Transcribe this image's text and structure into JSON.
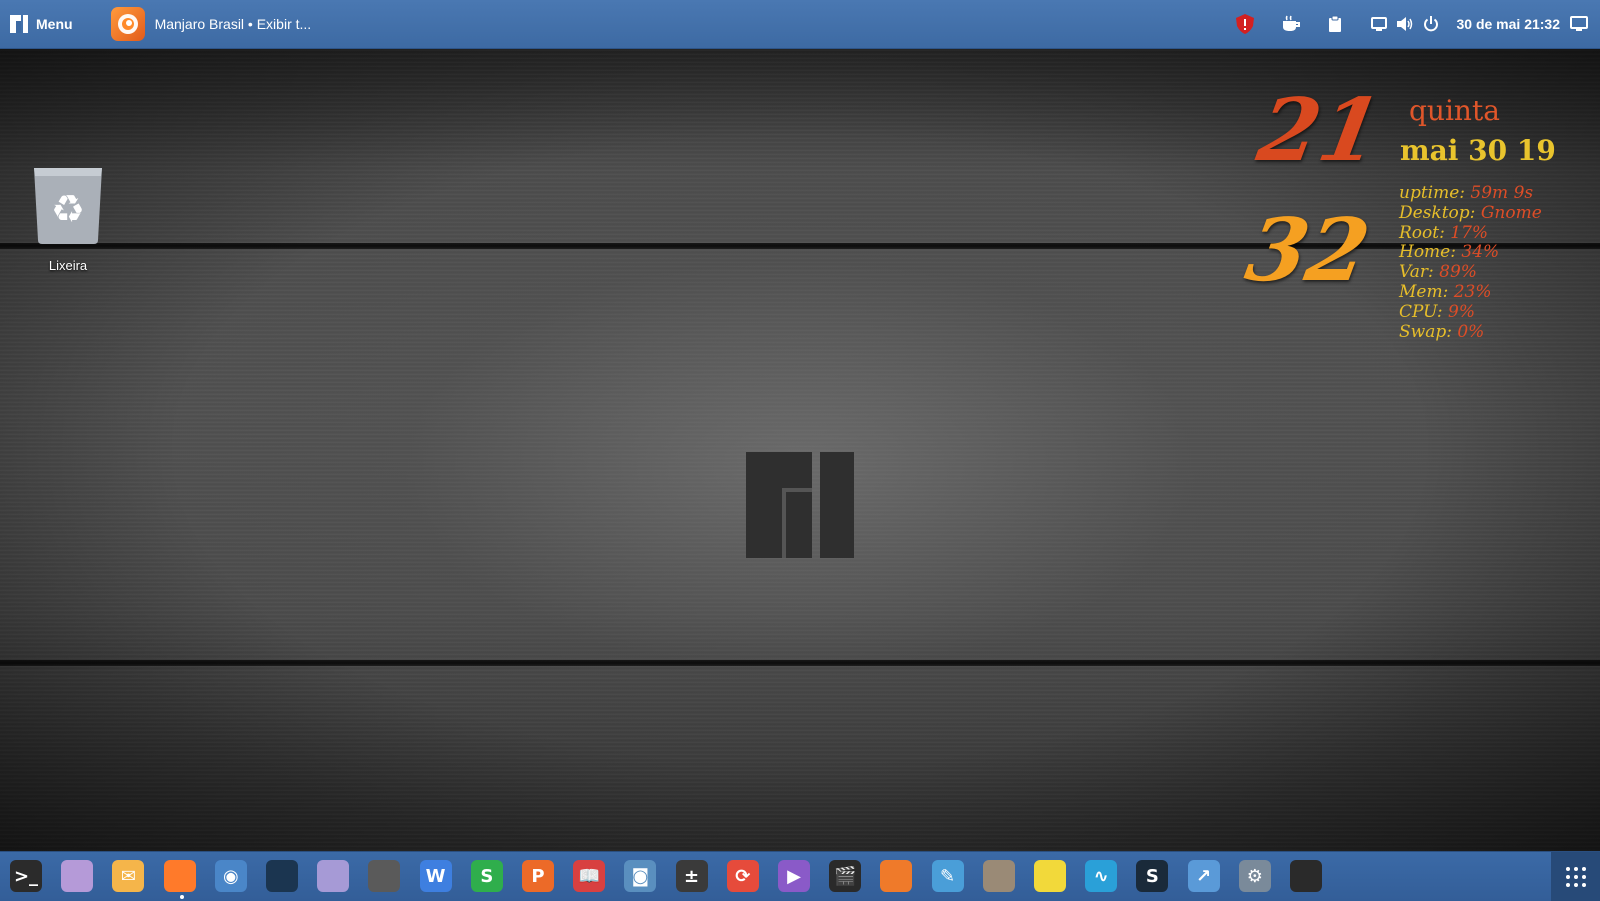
{
  "top_bar": {
    "menu_label": "Menu",
    "active_window_title": "Manjaro Brasil • Exibir t...",
    "tray_icons": [
      "shield-alert-icon",
      "coffee-icon",
      "clipboard-icon",
      "screen-icon",
      "volume-icon",
      "power-icon"
    ],
    "clock": "30 de mai  21:32",
    "show_desktop_icon": "show-desktop-icon"
  },
  "desktop": {
    "trash_label": "Lixeira"
  },
  "conky": {
    "hour": "21",
    "minute": "32",
    "weekday": "quinta",
    "date": "mai 30 19",
    "stats": [
      {
        "key": "uptime:",
        "value": "59m 9s"
      },
      {
        "key": "Desktop:",
        "value": " Gnome"
      },
      {
        "key": "Root:",
        "value": "17%"
      },
      {
        "key": "Home:",
        "value": "34%"
      },
      {
        "key": "Var:",
        "value": "89%"
      },
      {
        "key": "Mem:",
        "value": "23%"
      },
      {
        "key": "CPU:",
        "value": "9%"
      },
      {
        "key": "Swap:",
        "value": "0%"
      }
    ],
    "colors": {
      "hour": "#d9491f",
      "minute": "#f5a021",
      "label": "#e7be2a",
      "value": "#dd4d27"
    }
  },
  "dock": {
    "apps": [
      {
        "name": "terminal-icon",
        "color": "#2b2b2b",
        "glyph": ">_"
      },
      {
        "name": "files-icon",
        "color": "#b59ad8",
        "glyph": ""
      },
      {
        "name": "mail-icon",
        "color": "#f5b54a",
        "glyph": "✉"
      },
      {
        "name": "firefox-icon",
        "color": "#ff7a2a",
        "glyph": ""
      },
      {
        "name": "chrome-icon",
        "color": "#4a86c8",
        "glyph": "◉"
      },
      {
        "name": "steam-icon",
        "color": "#1b3550",
        "glyph": ""
      },
      {
        "name": "text-editor-icon",
        "color": "#a69ad6",
        "glyph": ""
      },
      {
        "name": "document-viewer-icon",
        "color": "#5a5a5a",
        "glyph": ""
      },
      {
        "name": "wps-writer-icon",
        "color": "#3e7fe0",
        "glyph": "W"
      },
      {
        "name": "wps-spreadsheets-icon",
        "color": "#2fae4c",
        "glyph": "S"
      },
      {
        "name": "wps-presentation-icon",
        "color": "#ec6a28",
        "glyph": "P"
      },
      {
        "name": "ebook-reader-icon",
        "color": "#d84040",
        "glyph": "📖"
      },
      {
        "name": "screenshot-icon",
        "color": "#5a8fbf",
        "glyph": "◙"
      },
      {
        "name": "calculator-icon",
        "color": "#3a3a3a",
        "glyph": "±"
      },
      {
        "name": "software-update-icon",
        "color": "#e64b3b",
        "glyph": "⟳"
      },
      {
        "name": "media-player-icon",
        "color": "#8a5ac8",
        "glyph": "▶"
      },
      {
        "name": "video-editor-icon",
        "color": "#2a2a2a",
        "glyph": "🎬"
      },
      {
        "name": "feather-app-icon",
        "color": "#ef7a2a",
        "glyph": ""
      },
      {
        "name": "drawing-app-icon",
        "color": "#4a9ed8",
        "glyph": "✎"
      },
      {
        "name": "gimp-icon",
        "color": "#9a8a76",
        "glyph": ""
      },
      {
        "name": "sticky-notes-icon",
        "color": "#f2d93a",
        "glyph": ""
      },
      {
        "name": "system-monitor-icon",
        "color": "#2aa0d8",
        "glyph": "∿"
      },
      {
        "name": "skype-icon",
        "color": "#1a2a3a",
        "glyph": "S"
      },
      {
        "name": "graph-app-icon",
        "color": "#5a9ad8",
        "glyph": "↗"
      },
      {
        "name": "settings-icon",
        "color": "#7a8a9a",
        "glyph": "⚙"
      },
      {
        "name": "clipboard-app-icon",
        "color": "#2a2a2a",
        "glyph": ""
      }
    ],
    "grid_icon": "show-applications-icon"
  }
}
